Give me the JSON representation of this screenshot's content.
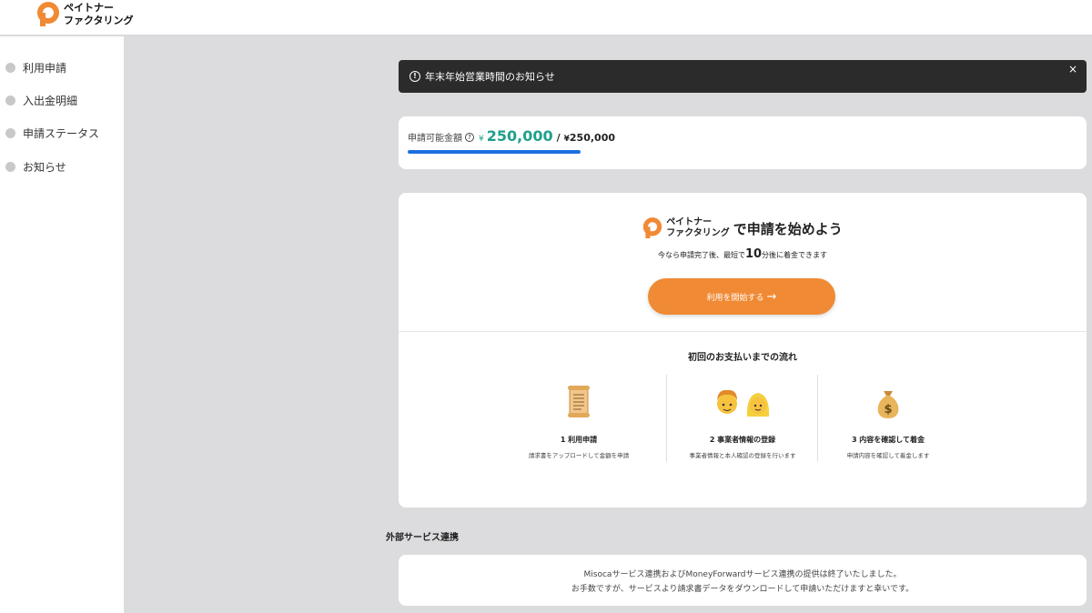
{
  "header": {
    "logo_line1": "ペイトナー",
    "logo_line2": "ファクタリング"
  },
  "sidebar": {
    "items": [
      {
        "label": "利用申請"
      },
      {
        "label": "入出金明細"
      },
      {
        "label": "申請ステータス"
      },
      {
        "label": "お知らせ"
      }
    ]
  },
  "notice": {
    "text": "年末年始営業時間のお知らせ",
    "close": "×"
  },
  "limit": {
    "label": "申請可能金額",
    "currency": "¥",
    "available": "250,000",
    "separator": "/",
    "total": "250,000",
    "progress": 1.0
  },
  "start": {
    "logo_line1": "ペイトナー",
    "logo_line2": "ファクタリング",
    "title": "で申請を始めよう",
    "sub_before": "今なら申請完了後、最短で",
    "sub_big": "10",
    "sub_after": "分後に着金できます",
    "button_label": "利用を開始する",
    "button_arrow": "→"
  },
  "flow": {
    "title": "初回のお支払いまでの流れ",
    "steps": [
      {
        "title": "1  利用申請",
        "desc": "請求書をアップロードして金額を申請",
        "icon": "scroll-icon"
      },
      {
        "title": "2  事業者情報の登録",
        "desc": "事業者情報と本人確認の登録を行います",
        "icon": "people-icon"
      },
      {
        "title": "3  内容を確認して着金",
        "desc": "申請内容を確認して着金します",
        "icon": "money-bag-icon"
      }
    ]
  },
  "external": {
    "title": "外部サービス連携",
    "line1": "Misocaサービス連携およびMoneyForwardサービス連携の提供は終了いたしました。",
    "line2": "お手数ですが、サービスより請求書データをダウンロードして申請いただけますと幸いです。"
  },
  "colors": {
    "brand_orange": "#f08a34",
    "accent_teal": "#20a08a",
    "progress_blue": "#1b6fe0",
    "notice_bg": "#2b2b2b"
  }
}
